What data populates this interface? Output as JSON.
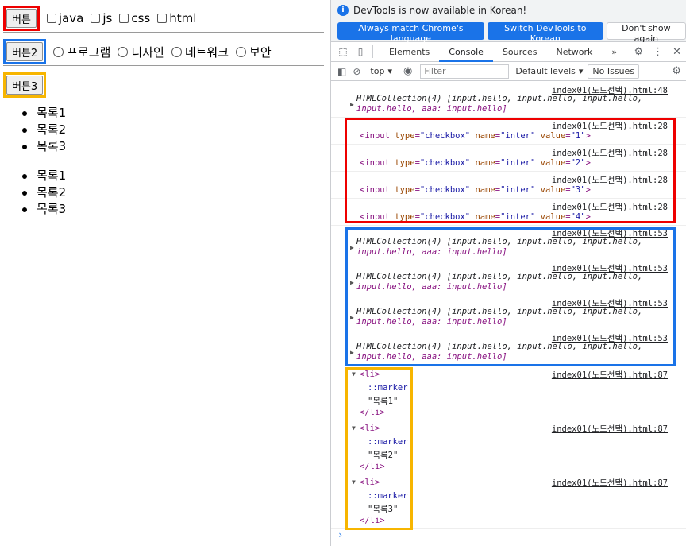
{
  "page": {
    "buttons": {
      "btn1": "버튼",
      "btn2": "버튼2",
      "btn3": "버튼3"
    },
    "checkboxes": [
      "java",
      "js",
      "css",
      "html"
    ],
    "radios": [
      "프로그램",
      "디자인",
      "네트워크",
      "보안"
    ],
    "list1": [
      "목록1",
      "목록2",
      "목록3"
    ],
    "list2": [
      "목록1",
      "목록2",
      "목록3"
    ]
  },
  "devtools": {
    "info": {
      "message": "DevTools is now available in Korean!",
      "btn_match": "Always match Chrome's language",
      "btn_switch": "Switch DevTools to Korean",
      "btn_dismiss": "Don't show again"
    },
    "tabs": [
      "Elements",
      "Console",
      "Sources",
      "Network"
    ],
    "more_tabs": "»",
    "toolbar": {
      "context": "top",
      "filter_placeholder": "Filter",
      "levels": "Default levels",
      "issues": "No Issues"
    },
    "sources": {
      "l48": "index01(노드선택).html:48",
      "l28": "index01(노드선택).html:28",
      "l53": "index01(노드선택).html:53",
      "l87": "index01(노드선택).html:87"
    },
    "collection_line1": "HTMLCollection(4) [input.hello, input.hello, input.hello,",
    "collection_line2": "input.hello, aaa: input.hello]",
    "checkbox_inputs": [
      "1",
      "2",
      "3",
      "4"
    ],
    "input_parts": {
      "open": "<input ",
      "type_attr": "type",
      "type_val": "\"checkbox\"",
      "name_attr": "name",
      "name_val": "\"inter\"",
      "value_attr": "value"
    },
    "li_open": "<li>",
    "li_close": "</li>",
    "marker": "::marker",
    "li_texts": [
      "\"목록1\"",
      "\"목록2\"",
      "\"목록3\""
    ],
    "prompt": "›"
  },
  "colors": {
    "red": "#ee0000",
    "blue": "#1a73e8",
    "yellow": "#f7b500"
  }
}
